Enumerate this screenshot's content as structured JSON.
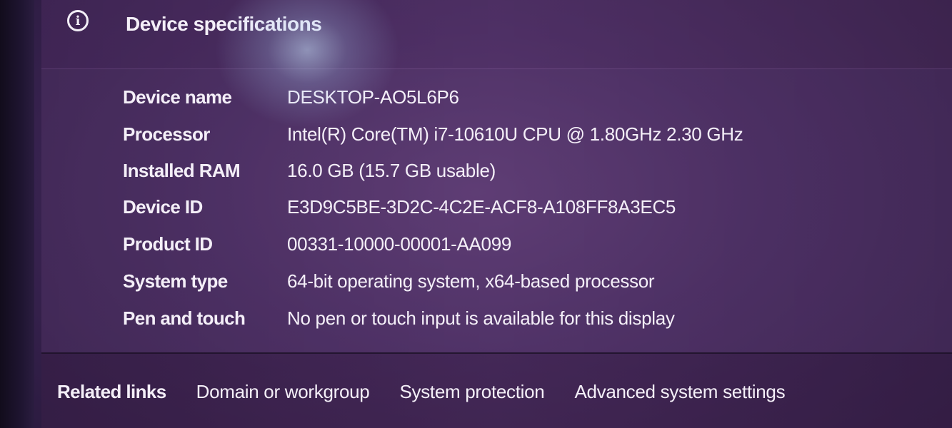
{
  "header": {
    "title": "Device specifications",
    "icon": "info-icon"
  },
  "specs": [
    {
      "label": "Device name",
      "value": "DESKTOP-AO5L6P6"
    },
    {
      "label": "Processor",
      "value": "Intel(R) Core(TM) i7-10610U CPU @ 1.80GHz   2.30 GHz"
    },
    {
      "label": "Installed RAM",
      "value": "16.0 GB (15.7 GB usable)"
    },
    {
      "label": "Device ID",
      "value": "E3D9C5BE-3D2C-4C2E-ACF8-A108FF8A3EC5"
    },
    {
      "label": "Product ID",
      "value": "00331-10000-00001-AA099"
    },
    {
      "label": "System type",
      "value": "64-bit operating system, x64-based processor"
    },
    {
      "label": "Pen and touch",
      "value": "No pen or touch input is available for this display"
    }
  ],
  "related": {
    "label": "Related links",
    "links": [
      "Domain or workgroup",
      "System protection",
      "Advanced system settings"
    ]
  }
}
